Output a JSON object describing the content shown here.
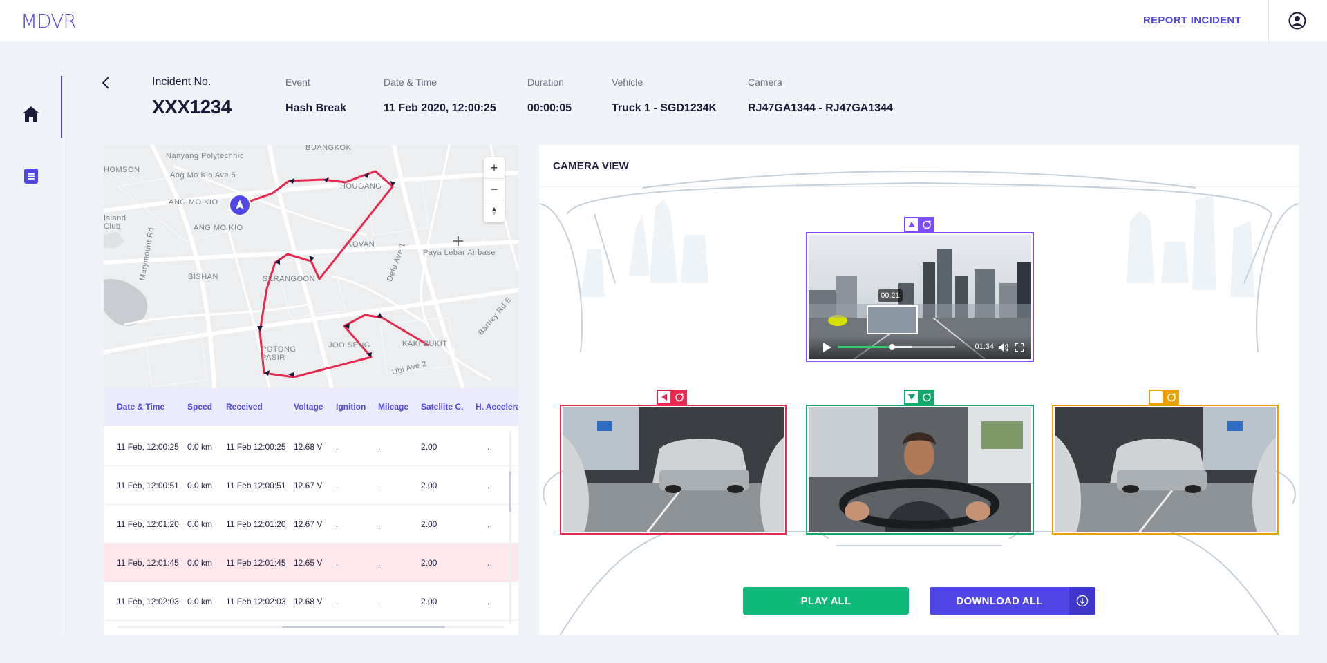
{
  "app": {
    "logo": "MDVR",
    "report_link": "REPORT INCIDENT"
  },
  "incident": {
    "number_label": "Incident No.",
    "number": "XXX1234",
    "fields": [
      {
        "label": "Event",
        "value": "Hash Break"
      },
      {
        "label": "Date & Time",
        "value": "11 Feb 2020, 12:00:25"
      },
      {
        "label": "Duration",
        "value": "00:00:05"
      },
      {
        "label": "Vehicle",
        "value": "Truck 1 - SGD1234K"
      },
      {
        "label": "Camera",
        "value": "RJ47GA1344 - RJ47GA1344"
      }
    ]
  },
  "map": {
    "labels": [
      "Nanyang Polytechnic",
      "BUANGKOK",
      "Ang Mo Kio Ave 5",
      "HOUGANG",
      "ANG MO KIO",
      "Island Club",
      "ANG MO KIO",
      "KOVAN",
      "Paya Lebar Airbase",
      "BISHAN",
      "SERANGOON",
      "Marymount Rd",
      "Defu Ave 1",
      "JOO SENG",
      "KAKI BUKIT",
      "POTONG PASIR",
      "Bartley Rd E",
      "Ubi Ave 2",
      "HOMSON"
    ],
    "zoom_in": "+",
    "zoom_out": "−"
  },
  "table": {
    "headers": [
      "Date & Time",
      "Speed",
      "Received",
      "Voltage",
      "Ignition",
      "Mileage",
      "Satellite C.",
      "H. Accelera"
    ],
    "rows": [
      [
        "11 Feb, 12:00:25",
        "0.0 km",
        "11 Feb 12:00:25",
        "12.68 V",
        ".",
        ".",
        "2.00",
        "."
      ],
      [
        "11 Feb, 12:00:51",
        "0.0 km",
        "11 Feb 12:00:51",
        "12.67 V",
        ".",
        ".",
        "2.00",
        "."
      ],
      [
        "11 Feb, 12:01:20",
        "0.0 km",
        "11 Feb 12:01:20",
        "12.67 V",
        ".",
        ".",
        "2.00",
        "."
      ],
      [
        "11 Feb, 12:01:45",
        "0.0 km",
        "11 Feb 12:01:45",
        "12.65 V",
        ".",
        ".",
        "2.00",
        "."
      ],
      [
        "11 Feb, 12:02:03",
        "0.0 km",
        "11 Feb 12:02:03",
        "12.68 V",
        ".",
        ".",
        "2.00",
        "."
      ]
    ],
    "highlighted_row": 3
  },
  "camera": {
    "title": "CAMERA VIEW",
    "front": {
      "hover_time": "00:21",
      "duration": "01:34",
      "progress": 0.46,
      "buffer": 0.63,
      "color": "#7c4dff"
    },
    "left": {
      "color": "#e8284f"
    },
    "cabin": {
      "color": "#12a86b"
    },
    "right": {
      "color": "#e8a100"
    },
    "play_all": "PLAY ALL",
    "download_all": "DOWNLOAD ALL"
  }
}
